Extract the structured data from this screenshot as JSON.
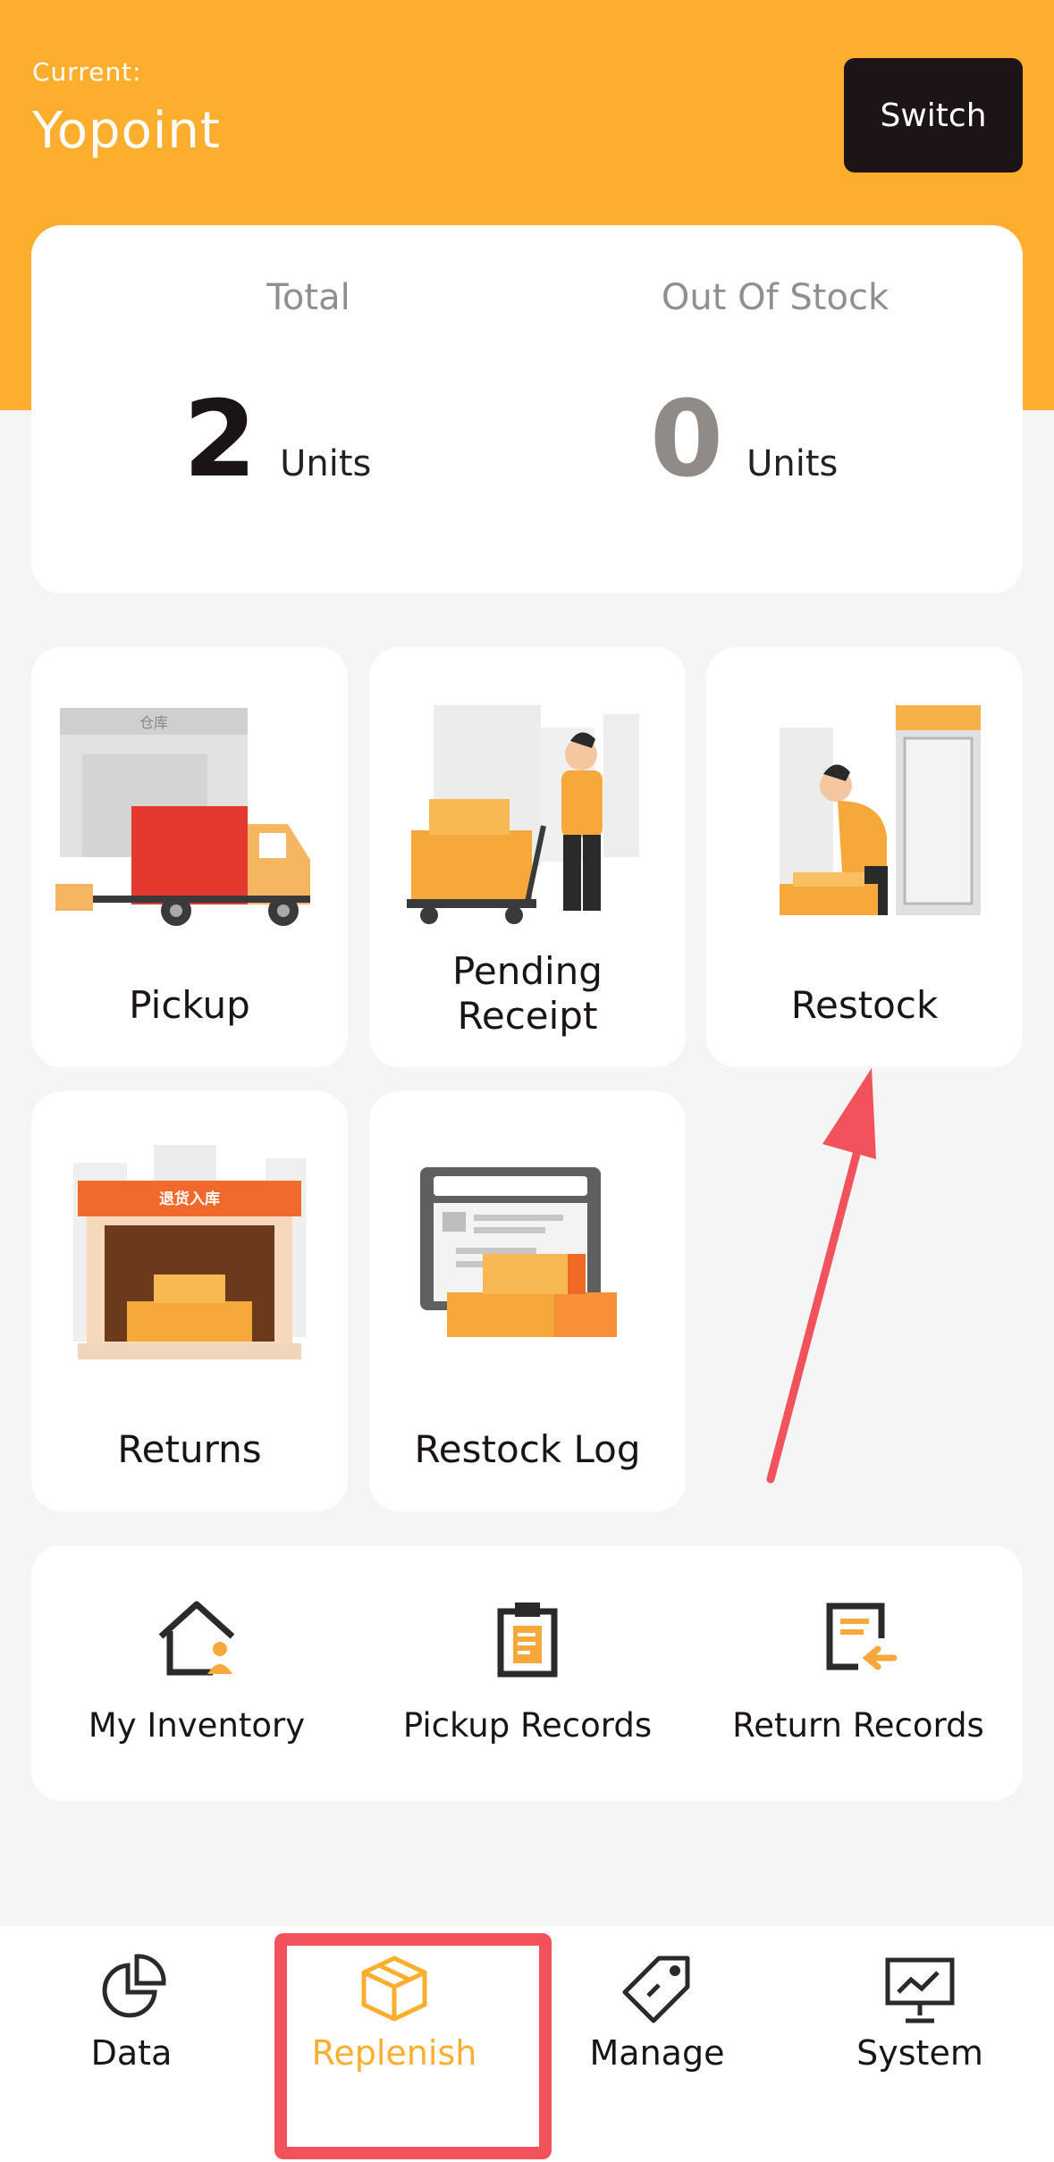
{
  "header": {
    "current_label": "Current:",
    "store_name": "Yopoint",
    "switch_label": "Switch",
    "background_color": "#fdae2e"
  },
  "stats": {
    "total": {
      "label": "Total",
      "value": "2",
      "unit": "Units"
    },
    "out_of_stock": {
      "label": "Out Of Stock",
      "value": "0",
      "unit": "Units"
    }
  },
  "tiles": [
    {
      "label": "Pickup",
      "icon": "truck-warehouse-illustration",
      "sign": "仓库"
    },
    {
      "label": "Pending\nReceipt",
      "icon": "person-pushing-cart-illustration"
    },
    {
      "label": "Restock",
      "icon": "person-restocking-fridge-illustration"
    },
    {
      "label": "Returns",
      "icon": "returns-warehouse-illustration",
      "sign": "退货入库"
    },
    {
      "label": "Restock Log",
      "icon": "restock-log-document-illustration"
    }
  ],
  "shortcuts": [
    {
      "label": "My Inventory",
      "icon": "house-person-icon"
    },
    {
      "label": "Pickup Records",
      "icon": "clipboard-icon"
    },
    {
      "label": "Return Records",
      "icon": "return-document-icon"
    }
  ],
  "tabbar": {
    "items": [
      {
        "label": "Data",
        "icon": "pie-chart-icon",
        "active": false
      },
      {
        "label": "Replenish",
        "icon": "box-icon",
        "active": true
      },
      {
        "label": "Manage",
        "icon": "tag-icon",
        "active": false
      },
      {
        "label": "System",
        "icon": "presentation-board-icon",
        "active": false
      }
    ],
    "active_color": "#fdae2e"
  },
  "annotations": {
    "highlight_color": "#f2525b",
    "arrow_target": "Restock"
  }
}
